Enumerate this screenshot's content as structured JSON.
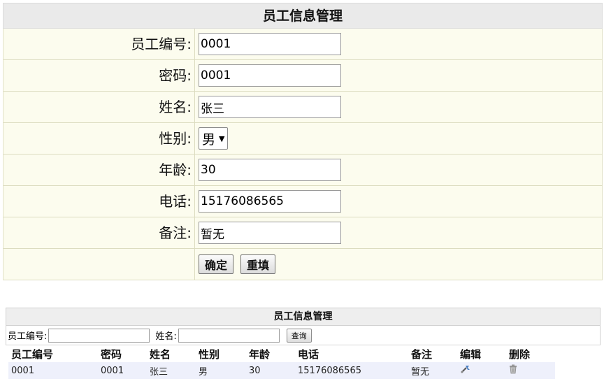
{
  "form": {
    "title": "员工信息管理",
    "fields": [
      {
        "label": "员工编号:",
        "value": "0001"
      },
      {
        "label": "密码:",
        "value": "0001"
      },
      {
        "label": "姓名:",
        "value": "张三"
      },
      {
        "label": "性别:",
        "value": "男"
      },
      {
        "label": "年龄:",
        "value": "30"
      },
      {
        "label": "电话:",
        "value": "15176086565"
      },
      {
        "label": "备注:",
        "value": "暂无"
      }
    ],
    "confirm_label": "确定",
    "reset_label": "重填"
  },
  "list": {
    "title": "员工信息管理",
    "search": {
      "id_label": "员工编号:",
      "id_value": "",
      "name_label": "姓名:",
      "name_value": "",
      "query_label": "查询"
    },
    "columns": [
      "员工编号",
      "密码",
      "姓名",
      "性别",
      "年龄",
      "电话",
      "备注",
      "编辑",
      "删除"
    ],
    "rows": [
      {
        "id": "0001",
        "password": "0001",
        "name": "张三",
        "gender": "男",
        "age": "30",
        "phone": "15176086565",
        "note": "暂无",
        "edit_icon": "edit-icon",
        "delete_icon": "trash-icon"
      }
    ]
  }
}
